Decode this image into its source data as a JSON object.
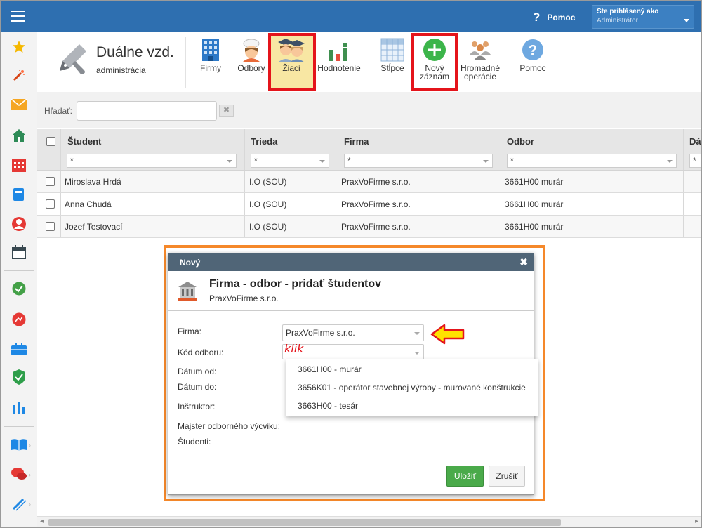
{
  "topbar": {
    "help_label": "Pomoc",
    "user_line1": "Ste prihlásený ako",
    "user_line2": "Administrátor"
  },
  "sidebar": {
    "icons": [
      "star-icon",
      "wand-icon",
      "mail-icon",
      "home-icon",
      "calendar-grid-icon",
      "book-icon",
      "user-icon",
      "calendar-icon",
      "check-icon",
      "chart-circle-icon",
      "briefcase-icon",
      "shield-icon",
      "bar-chart-icon",
      "open-book-icon",
      "chat-icon",
      "pen-icon"
    ]
  },
  "module": {
    "title": "Duálne vzd.",
    "subtitle": "administrácia"
  },
  "ribbon": {
    "firmy": "Firmy",
    "odbory": "Odbory",
    "ziaci": "Žiaci",
    "hodnotenie": "Hodnotenie",
    "stlpce": "Stĺpce",
    "novy_1": "Nový",
    "novy_2": "záznam",
    "hromadne_1": "Hromadné",
    "hromadne_2": "operácie",
    "pomoc": "Pomoc"
  },
  "search": {
    "label": "Hľadať:",
    "value": "",
    "clear": "✖"
  },
  "grid": {
    "headers": {
      "student": "Študent",
      "trieda": "Trieda",
      "firma": "Firma",
      "odbor": "Odbor",
      "da": "Dá"
    },
    "filter_value": "*",
    "rows": [
      {
        "student": "Miroslava Hrdá",
        "trieda": "I.O (SOU)",
        "firma": "PraxVoFirme s.r.o.",
        "odbor": "3661H00 murár"
      },
      {
        "student": "Anna Chudá",
        "trieda": "I.O (SOU)",
        "firma": "PraxVoFirme s.r.o.",
        "odbor": "3661H00 murár"
      },
      {
        "student": "Jozef Testovací",
        "trieda": "I.O (SOU)",
        "firma": "PraxVoFirme s.r.o.",
        "odbor": "3661H00 murár"
      }
    ]
  },
  "modal": {
    "header": "Nový",
    "close": "✖",
    "title": "Firma - odbor - pridať študentov",
    "subtitle": "PraxVoFirme s.r.o.",
    "labels": {
      "firma": "Firma:",
      "kod": "Kód odboru:",
      "datum_od": "Dátum od:",
      "datum_do": "Dátum do:",
      "instruktor": "Inštruktor:",
      "majster": "Majster odborného výcviku:",
      "studenti": "Študenti:"
    },
    "firma_value": "PraxVoFirme s.r.o.",
    "kod_value": "",
    "annotation": "klik",
    "dropdown": [
      "3661H00 - murár",
      "3656K01 - operátor stavebnej výroby - murované konštrukcie",
      "3663H00 - tesár"
    ],
    "save": "Uložiť",
    "cancel": "Zrušiť"
  },
  "colors": {
    "topbar": "#2e6fb0",
    "highlight_red": "#e4141b",
    "frame_orange": "#f5882a",
    "save_green": "#4aaa4a",
    "arrow_yellow": "#ffe100"
  }
}
